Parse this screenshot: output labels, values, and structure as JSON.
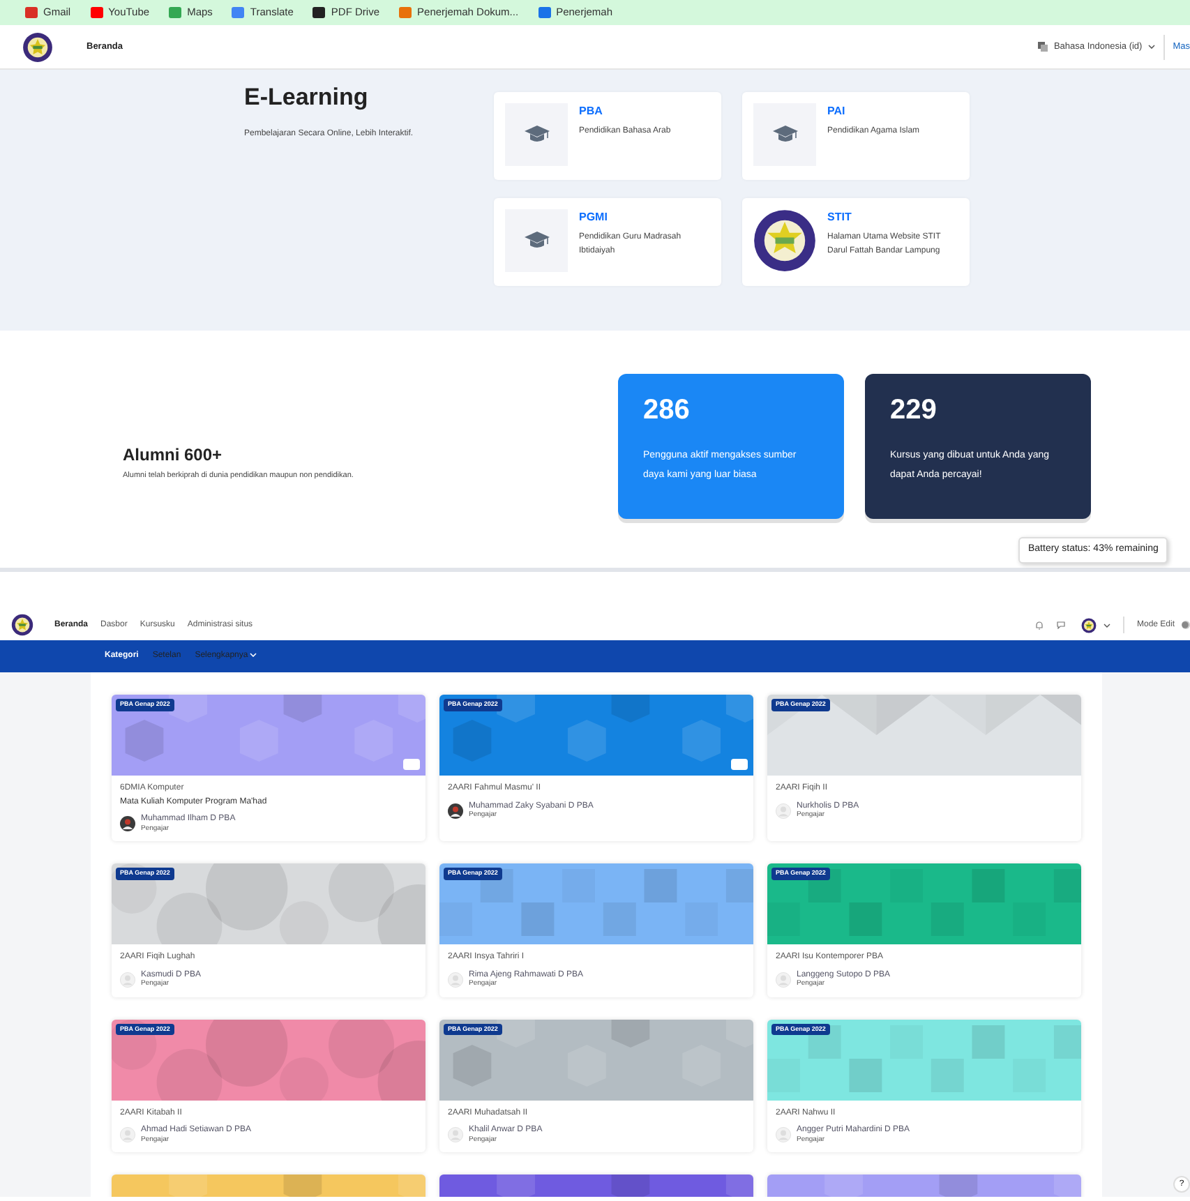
{
  "bookmarks": [
    {
      "label": "Gmail",
      "color": "#d93025"
    },
    {
      "label": "YouTube",
      "color": "#ff0000"
    },
    {
      "label": "Maps",
      "color": "#34a853"
    },
    {
      "label": "Translate",
      "color": "#4285f4"
    },
    {
      "label": "PDF Drive",
      "color": "#222222"
    },
    {
      "label": "Penerjemah Dokum...",
      "color": "#e8710a"
    },
    {
      "label": "Penerjemah",
      "color": "#1a73e8"
    }
  ],
  "top_nav": {
    "home": "Beranda",
    "language": "Bahasa Indonesia (id)",
    "login": "Mas"
  },
  "hero": {
    "title": "E-Learning",
    "subtitle": "Pembelajaran Secara Online, Lebih Interaktif."
  },
  "programs": [
    {
      "code": "PBA",
      "name": "Pendidikan Bahasa Arab",
      "kind": "cap"
    },
    {
      "code": "PAI",
      "name": "Pendidikan Agama Islam",
      "kind": "cap"
    },
    {
      "code": "PGMI",
      "name": "Pendidikan Guru Madrasah Ibtidaiyah",
      "kind": "cap"
    },
    {
      "code": "STIT",
      "name": "Halaman Utama Website STIT Darul Fattah Bandar Lampung",
      "kind": "seal"
    }
  ],
  "alumni": {
    "title": "Alumni 600+",
    "text": "Alumni telah berkiprah di dunia pendidikan maupun non pendidikan."
  },
  "stats": [
    {
      "number": "286",
      "text": "Pengguna aktif mengakses sumber daya kami yang luar biasa",
      "color": "#1a87f5"
    },
    {
      "number": "229",
      "text": "Kursus yang dibuat untuk Anda yang dapat Anda percayai!",
      "color": "#22304f"
    }
  ],
  "tooltip": "Battery status: 43% remaining",
  "site_nav": {
    "links": [
      {
        "label": "Beranda",
        "selected": true
      },
      {
        "label": "Dasbor",
        "selected": false
      },
      {
        "label": "Kursusku",
        "selected": false
      },
      {
        "label": "Administrasi situs",
        "selected": false
      }
    ],
    "mode_edit": "Mode Edit",
    "mode_edit_on": false
  },
  "sub_nav": [
    {
      "label": "Kategori",
      "selected": true,
      "dropdown": false
    },
    {
      "label": "Setelan",
      "selected": false,
      "dropdown": false
    },
    {
      "label": "Selengkapnya",
      "selected": false,
      "dropdown": true
    }
  ],
  "courses": [
    {
      "badge": "PBA Genap 2022",
      "title": "6DMIA Komputer",
      "subtitle": "Mata Kuliah Komputer Program Ma'had",
      "teacher": "Muhammad Ilham D PBA",
      "role": "Pengajar",
      "photo_avatar": true,
      "color": "#a39ef5",
      "kind": "hex",
      "zoom_button": true
    },
    {
      "badge": "PBA Genap 2022",
      "title": "2AARI Fahmul Masmu' II",
      "teacher": "Muhammad Zaky Syabani D PBA",
      "role": "Pengajar",
      "photo_avatar": true,
      "color": "#1483e0",
      "kind": "hex",
      "zoom_button": true
    },
    {
      "badge": "PBA Genap 2022",
      "title": "2AARI Fiqih II",
      "teacher": "Nurkholis D PBA",
      "role": "Pengajar",
      "photo_avatar": false,
      "color": "#dfe3e6",
      "kind": "triangle",
      "zoom_button": false
    },
    {
      "badge": "PBA Genap 2022",
      "title": "2AARI Fiqih Lughah",
      "teacher": "Kasmudi D PBA",
      "role": "Pengajar",
      "photo_avatar": false,
      "color": "#d8dadc",
      "kind": "circle",
      "zoom_button": false
    },
    {
      "badge": "PBA Genap 2022",
      "title": "2AARI Insya Tahriri I",
      "teacher": "Rima Ajeng Rahmawati D PBA",
      "role": "Pengajar",
      "photo_avatar": false,
      "color": "#7ab4f5",
      "kind": "square",
      "zoom_button": false
    },
    {
      "badge": "PBA Genap 2022",
      "title": "2AARI Isu Kontemporer PBA",
      "teacher": "Langgeng Sutopo D PBA",
      "role": "Pengajar",
      "photo_avatar": false,
      "color": "#1ab98a",
      "kind": "square",
      "zoom_button": false
    },
    {
      "badge": "PBA Genap 2022",
      "title": "2AARI Kitabah II",
      "teacher": "Ahmad Hadi Setiawan D PBA",
      "role": "Pengajar",
      "photo_avatar": false,
      "color": "#f08aa8",
      "kind": "circle",
      "zoom_button": false
    },
    {
      "badge": "PBA Genap 2022",
      "title": "2AARI Muhadatsah II",
      "teacher": "Khalil Anwar D PBA",
      "role": "Pengajar",
      "photo_avatar": false,
      "color": "#b3bcc2",
      "kind": "hex",
      "zoom_button": false
    },
    {
      "badge": "PBA Genap 2022",
      "title": "2AARI Nahwu II",
      "teacher": "Angger Putri Mahardini D PBA",
      "role": "Pengajar",
      "photo_avatar": false,
      "color": "#7ee6e0",
      "kind": "square",
      "zoom_button": false
    },
    {
      "color": "#f5c75e",
      "kind": "hex"
    },
    {
      "color": "#6f5be0",
      "kind": "hex"
    },
    {
      "color": "#a39ef5",
      "kind": "hex"
    }
  ],
  "help": "?"
}
